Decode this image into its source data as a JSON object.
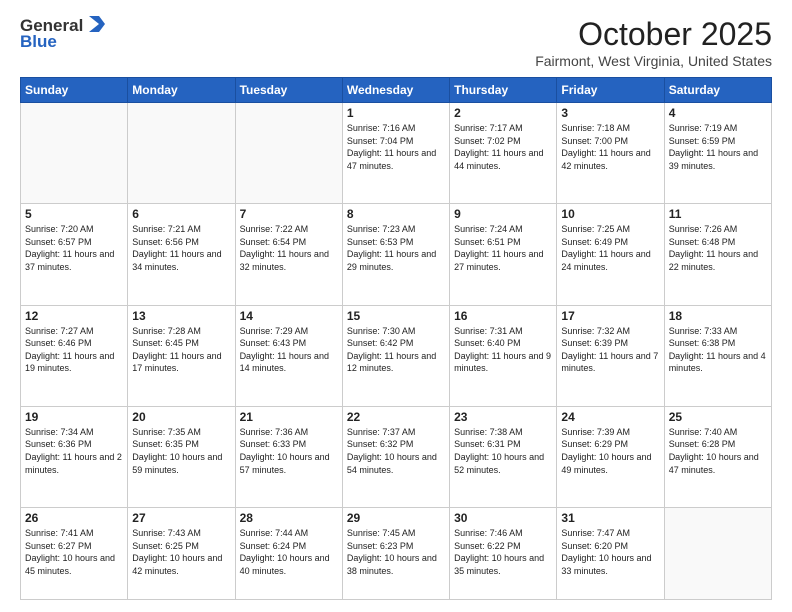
{
  "header": {
    "logo_general": "General",
    "logo_blue": "Blue",
    "month_title": "October 2025",
    "location": "Fairmont, West Virginia, United States"
  },
  "days_of_week": [
    "Sunday",
    "Monday",
    "Tuesday",
    "Wednesday",
    "Thursday",
    "Friday",
    "Saturday"
  ],
  "weeks": [
    [
      {
        "day": "",
        "info": ""
      },
      {
        "day": "",
        "info": ""
      },
      {
        "day": "",
        "info": ""
      },
      {
        "day": "1",
        "info": "Sunrise: 7:16 AM\nSunset: 7:04 PM\nDaylight: 11 hours and 47 minutes."
      },
      {
        "day": "2",
        "info": "Sunrise: 7:17 AM\nSunset: 7:02 PM\nDaylight: 11 hours and 44 minutes."
      },
      {
        "day": "3",
        "info": "Sunrise: 7:18 AM\nSunset: 7:00 PM\nDaylight: 11 hours and 42 minutes."
      },
      {
        "day": "4",
        "info": "Sunrise: 7:19 AM\nSunset: 6:59 PM\nDaylight: 11 hours and 39 minutes."
      }
    ],
    [
      {
        "day": "5",
        "info": "Sunrise: 7:20 AM\nSunset: 6:57 PM\nDaylight: 11 hours and 37 minutes."
      },
      {
        "day": "6",
        "info": "Sunrise: 7:21 AM\nSunset: 6:56 PM\nDaylight: 11 hours and 34 minutes."
      },
      {
        "day": "7",
        "info": "Sunrise: 7:22 AM\nSunset: 6:54 PM\nDaylight: 11 hours and 32 minutes."
      },
      {
        "day": "8",
        "info": "Sunrise: 7:23 AM\nSunset: 6:53 PM\nDaylight: 11 hours and 29 minutes."
      },
      {
        "day": "9",
        "info": "Sunrise: 7:24 AM\nSunset: 6:51 PM\nDaylight: 11 hours and 27 minutes."
      },
      {
        "day": "10",
        "info": "Sunrise: 7:25 AM\nSunset: 6:49 PM\nDaylight: 11 hours and 24 minutes."
      },
      {
        "day": "11",
        "info": "Sunrise: 7:26 AM\nSunset: 6:48 PM\nDaylight: 11 hours and 22 minutes."
      }
    ],
    [
      {
        "day": "12",
        "info": "Sunrise: 7:27 AM\nSunset: 6:46 PM\nDaylight: 11 hours and 19 minutes."
      },
      {
        "day": "13",
        "info": "Sunrise: 7:28 AM\nSunset: 6:45 PM\nDaylight: 11 hours and 17 minutes."
      },
      {
        "day": "14",
        "info": "Sunrise: 7:29 AM\nSunset: 6:43 PM\nDaylight: 11 hours and 14 minutes."
      },
      {
        "day": "15",
        "info": "Sunrise: 7:30 AM\nSunset: 6:42 PM\nDaylight: 11 hours and 12 minutes."
      },
      {
        "day": "16",
        "info": "Sunrise: 7:31 AM\nSunset: 6:40 PM\nDaylight: 11 hours and 9 minutes."
      },
      {
        "day": "17",
        "info": "Sunrise: 7:32 AM\nSunset: 6:39 PM\nDaylight: 11 hours and 7 minutes."
      },
      {
        "day": "18",
        "info": "Sunrise: 7:33 AM\nSunset: 6:38 PM\nDaylight: 11 hours and 4 minutes."
      }
    ],
    [
      {
        "day": "19",
        "info": "Sunrise: 7:34 AM\nSunset: 6:36 PM\nDaylight: 11 hours and 2 minutes."
      },
      {
        "day": "20",
        "info": "Sunrise: 7:35 AM\nSunset: 6:35 PM\nDaylight: 10 hours and 59 minutes."
      },
      {
        "day": "21",
        "info": "Sunrise: 7:36 AM\nSunset: 6:33 PM\nDaylight: 10 hours and 57 minutes."
      },
      {
        "day": "22",
        "info": "Sunrise: 7:37 AM\nSunset: 6:32 PM\nDaylight: 10 hours and 54 minutes."
      },
      {
        "day": "23",
        "info": "Sunrise: 7:38 AM\nSunset: 6:31 PM\nDaylight: 10 hours and 52 minutes."
      },
      {
        "day": "24",
        "info": "Sunrise: 7:39 AM\nSunset: 6:29 PM\nDaylight: 10 hours and 49 minutes."
      },
      {
        "day": "25",
        "info": "Sunrise: 7:40 AM\nSunset: 6:28 PM\nDaylight: 10 hours and 47 minutes."
      }
    ],
    [
      {
        "day": "26",
        "info": "Sunrise: 7:41 AM\nSunset: 6:27 PM\nDaylight: 10 hours and 45 minutes."
      },
      {
        "day": "27",
        "info": "Sunrise: 7:43 AM\nSunset: 6:25 PM\nDaylight: 10 hours and 42 minutes."
      },
      {
        "day": "28",
        "info": "Sunrise: 7:44 AM\nSunset: 6:24 PM\nDaylight: 10 hours and 40 minutes."
      },
      {
        "day": "29",
        "info": "Sunrise: 7:45 AM\nSunset: 6:23 PM\nDaylight: 10 hours and 38 minutes."
      },
      {
        "day": "30",
        "info": "Sunrise: 7:46 AM\nSunset: 6:22 PM\nDaylight: 10 hours and 35 minutes."
      },
      {
        "day": "31",
        "info": "Sunrise: 7:47 AM\nSunset: 6:20 PM\nDaylight: 10 hours and 33 minutes."
      },
      {
        "day": "",
        "info": ""
      }
    ]
  ]
}
